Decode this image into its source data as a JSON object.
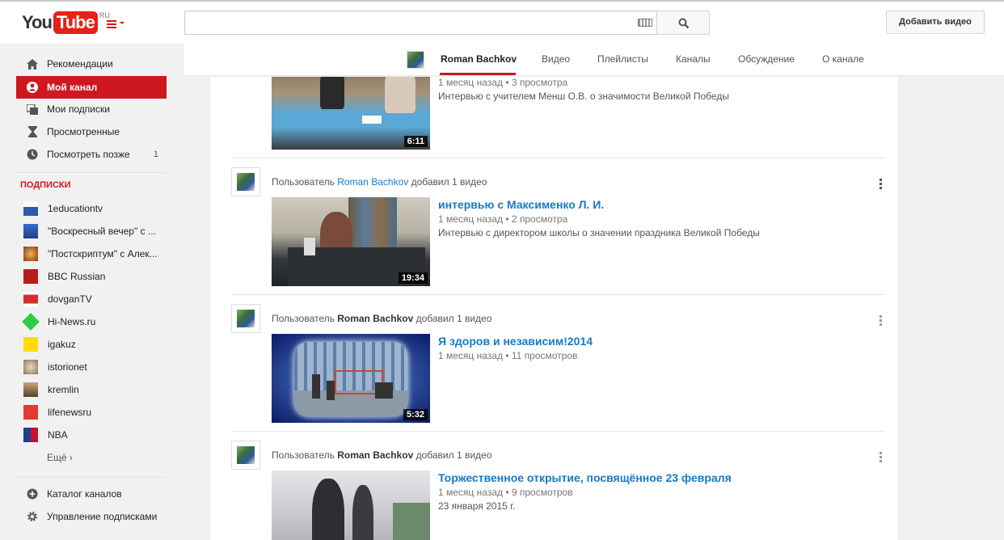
{
  "masthead": {
    "logo_you": "You",
    "logo_tube": "Tube",
    "logo_region": "RU",
    "search_value": "",
    "search_placeholder": "",
    "upload_label": "Добавить видео"
  },
  "sidebar": {
    "nav": [
      {
        "label": "Рекомендации",
        "icon": "home-icon"
      },
      {
        "label": "Мой канал",
        "icon": "user-icon",
        "active": true
      },
      {
        "label": "Мои подписки",
        "icon": "subscriptions-icon"
      },
      {
        "label": "Просмотренные",
        "icon": "hourglass-icon"
      },
      {
        "label": "Посмотреть позже",
        "icon": "clock-icon",
        "count": "1"
      }
    ],
    "subs_heading": "ПОДПИСКИ",
    "subscriptions": [
      {
        "label": "1educationtv",
        "color": "#2a5caa"
      },
      {
        "label": "\"Воскресный вечер\" с ...",
        "color": "#1d3f8a"
      },
      {
        "label": "\"Постскриптум\" с Алек...",
        "color": "#b5651d"
      },
      {
        "label": "BBC Russian",
        "color": "#b71c1c"
      },
      {
        "label": "dovganTV",
        "color": "#d32f2f"
      },
      {
        "label": "Hi-News.ru",
        "color": "#2ecc40"
      },
      {
        "label": "igakuz",
        "color": "#ffdd00"
      },
      {
        "label": "istorionet",
        "color": "#c9b79c"
      },
      {
        "label": "kremlin",
        "color": "#8b6b4a"
      },
      {
        "label": "lifenewsru",
        "color": "#e53935"
      },
      {
        "label": "NBA",
        "color": "#1d428a"
      }
    ],
    "more_label": "Ещё ›",
    "bottom": [
      {
        "label": "Каталог каналов",
        "icon": "plus-circle-icon"
      },
      {
        "label": "Управление подписками",
        "icon": "gear-icon"
      }
    ]
  },
  "channel_nav": {
    "channel_name": "Roman Bachkov",
    "tabs": [
      "Видео",
      "Плейлисты",
      "Каналы",
      "Обсуждение",
      "О канале"
    ]
  },
  "feed": {
    "head_prefix": "Пользователь",
    "head_suffix": "добавил 1 видео",
    "user": "Roman Bachkov",
    "items": [
      {
        "title": "",
        "age": "1 месяц назад",
        "views": "3 просмотра",
        "description": "Интервью с учителем Менш О.В. о значимости Великой Победы",
        "duration": "6:11"
      },
      {
        "title": "интервью с Максименко Л. И.",
        "age": "1 месяц назад",
        "views": "2 просмотра",
        "description": "Интервью с директором школы о значении праздника Великой Победы",
        "duration": "19:34"
      },
      {
        "title": "Я здоров и независим!2014",
        "age": "1 месяц назад",
        "views": "11 просмотров",
        "description": "",
        "duration": "5:32"
      },
      {
        "title": "Торжественное открытие, посвящённое 23 февраля",
        "age": "1 месяц назад",
        "views": "9 просмотров",
        "description": "23 января 2015 г.",
        "duration": ""
      }
    ],
    "meta_separator": "•"
  },
  "colors": {
    "brand_red": "#cc181e",
    "link_blue": "#167ac6"
  }
}
